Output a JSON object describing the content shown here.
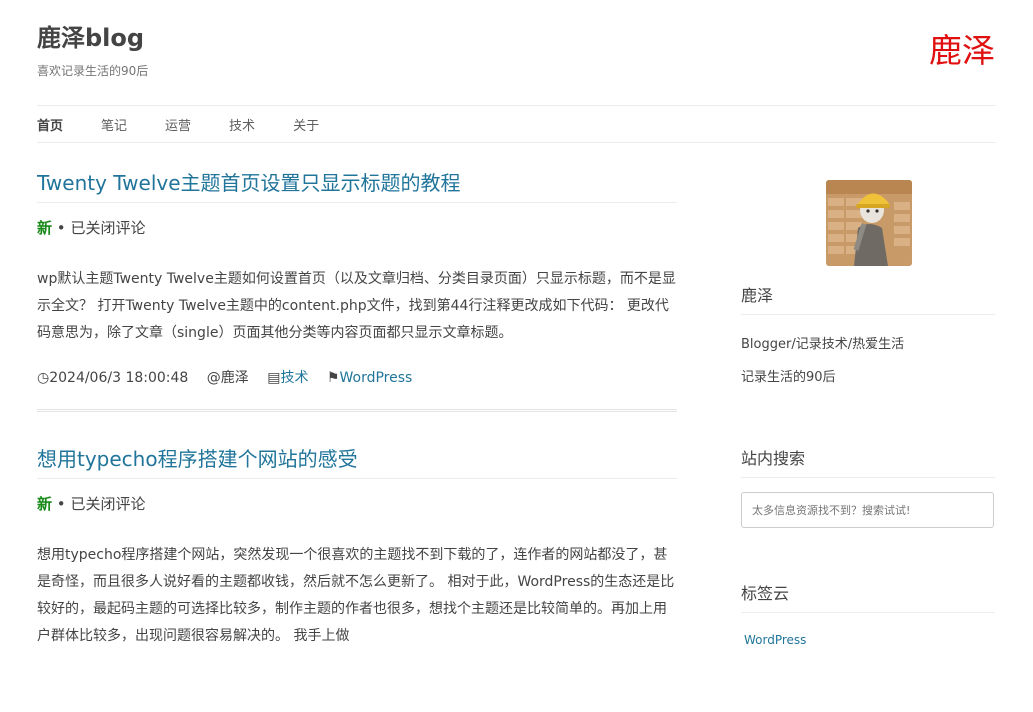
{
  "site": {
    "title": "鹿泽blog",
    "description": "喜欢记录生活的90后",
    "brand_mark": "鹿泽"
  },
  "nav": {
    "items": [
      {
        "label": "首页",
        "current": true
      },
      {
        "label": "笔记"
      },
      {
        "label": "运营"
      },
      {
        "label": "技术"
      },
      {
        "label": "关于"
      }
    ]
  },
  "posts": [
    {
      "title": "Twenty Twelve主题首页设置只显示标题的教程",
      "badge": "新",
      "separator": "•",
      "comments": "已关闭评论",
      "excerpt": "wp默认主题Twenty Twelve主题如何设置首页（以及文章归档、分类目录页面）只显示标题，而不是显示全文？ 打开Twenty Twelve主题中的content.php文件，找到第44行注释更改成如下代码： 更改代码意思为，除了文章（single）页面其他分类等内容页面都只显示文章标题。",
      "date": "◷2024/06/3 18:00:48",
      "author": "@鹿泽",
      "category_icon": "▤",
      "category": "技术",
      "tag_icon": "⚑",
      "tag": "WordPress"
    },
    {
      "title": "想用typecho程序搭建个网站的感受",
      "badge": "新",
      "separator": "•",
      "comments": "已关闭评论",
      "excerpt": "想用typecho程序搭建个网站，突然发现一个很喜欢的主题找不到下载的了，连作者的网站都没了，甚是奇怪，而且很多人说好看的主题都收钱，然后就不怎么更新了。 相对于此，WordPress的生态还是比较好的，最起码主题的可选择比较多，制作主题的作者也很多，想找个主题还是比较简单的。再加上用户群体比较多，出现问题很容易解决的。 我手上做"
    }
  ],
  "sidebar": {
    "author": {
      "name": "鹿泽",
      "bio1": "Blogger/记录技术/热爱生活",
      "bio2": "记录生活的90后"
    },
    "search": {
      "title": "站内搜索",
      "placeholder": "太多信息资源找不到？搜索试试!"
    },
    "tags": {
      "title": "标签云",
      "items": [
        "WordPress"
      ]
    }
  }
}
